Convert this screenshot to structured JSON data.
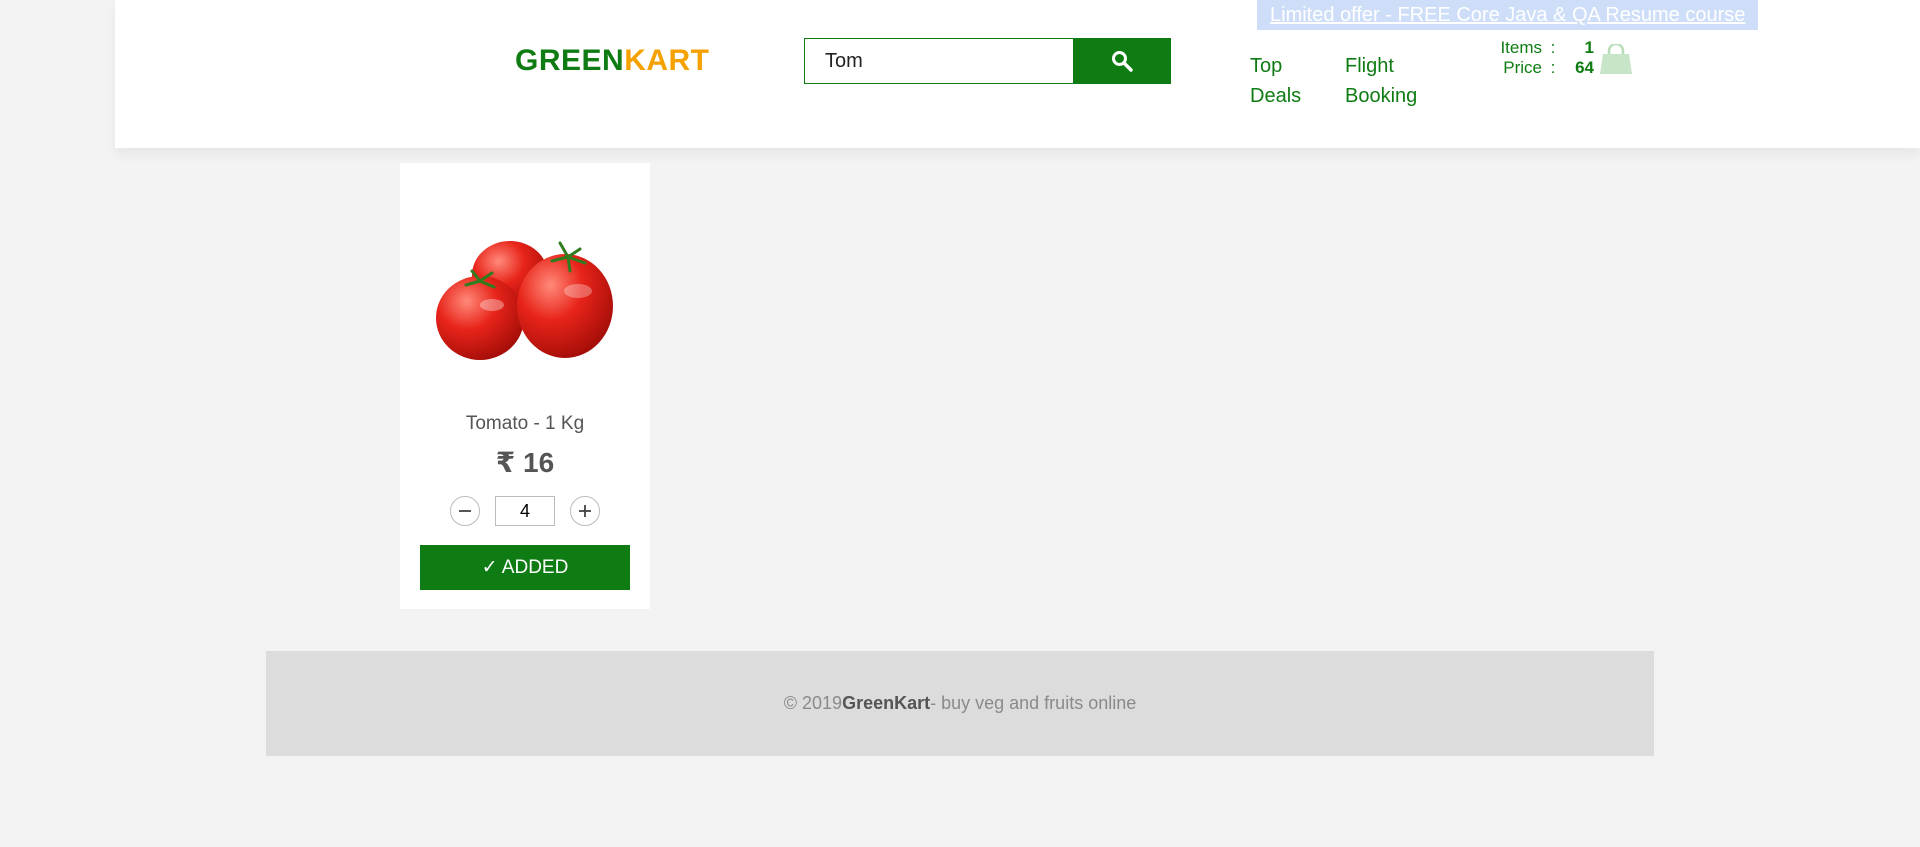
{
  "header": {
    "offer_link": "Limited offer - FREE Core Java & QA Resume course",
    "brand_green": "GREEN",
    "brand_orange": "KART",
    "search": {
      "value": "Tom",
      "placeholder": ""
    },
    "nav": {
      "top_deals": "Top Deals",
      "flight_booking": "Flight Booking"
    },
    "cart": {
      "items_label": "Items",
      "items_value": "1",
      "price_label": "Price",
      "price_value": "64",
      "separator": ":"
    }
  },
  "products": [
    {
      "name": "Tomato - 1 Kg",
      "price": "₹ 16",
      "quantity": "4",
      "button_label": "✓ ADDED"
    }
  ],
  "footer": {
    "prefix": "© 2019 ",
    "brand": "GreenKart",
    "suffix": " - buy veg and fruits online"
  },
  "colors": {
    "brand_green": "#0f7c13",
    "brand_orange": "#f5a100",
    "offer_bg": "#cfdef8"
  }
}
